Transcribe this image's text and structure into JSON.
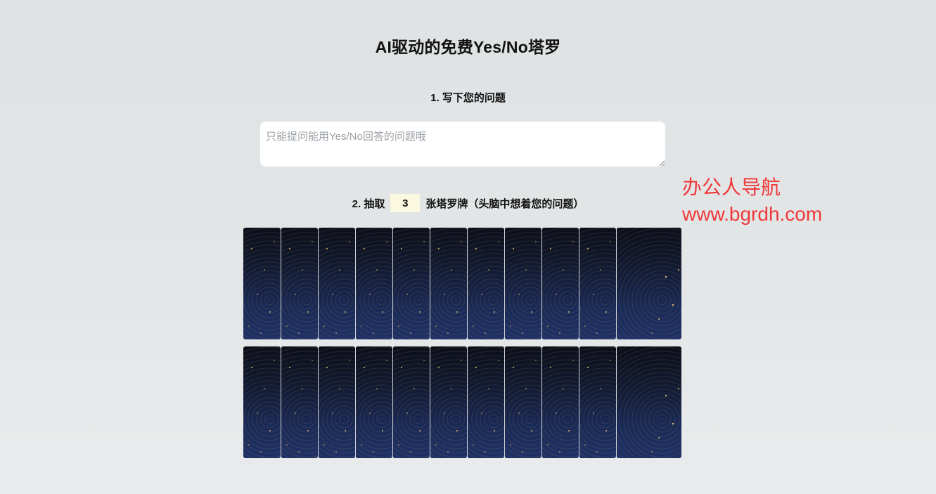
{
  "title": "AI驱动的免费Yes/No塔罗",
  "step1": {
    "label": "1. 写下您的问题",
    "placeholder": "只能提问能用Yes/No回答的问题哦",
    "value": ""
  },
  "step2": {
    "prefix": "2. 抽取",
    "count": "3",
    "suffix": "张塔罗牌（头脑中想着您的问题）"
  },
  "watermark": {
    "line1": "办公人导航",
    "line2": "www.bgrdh.com"
  },
  "deck": {
    "rows": 2,
    "cards_per_row": 11
  }
}
